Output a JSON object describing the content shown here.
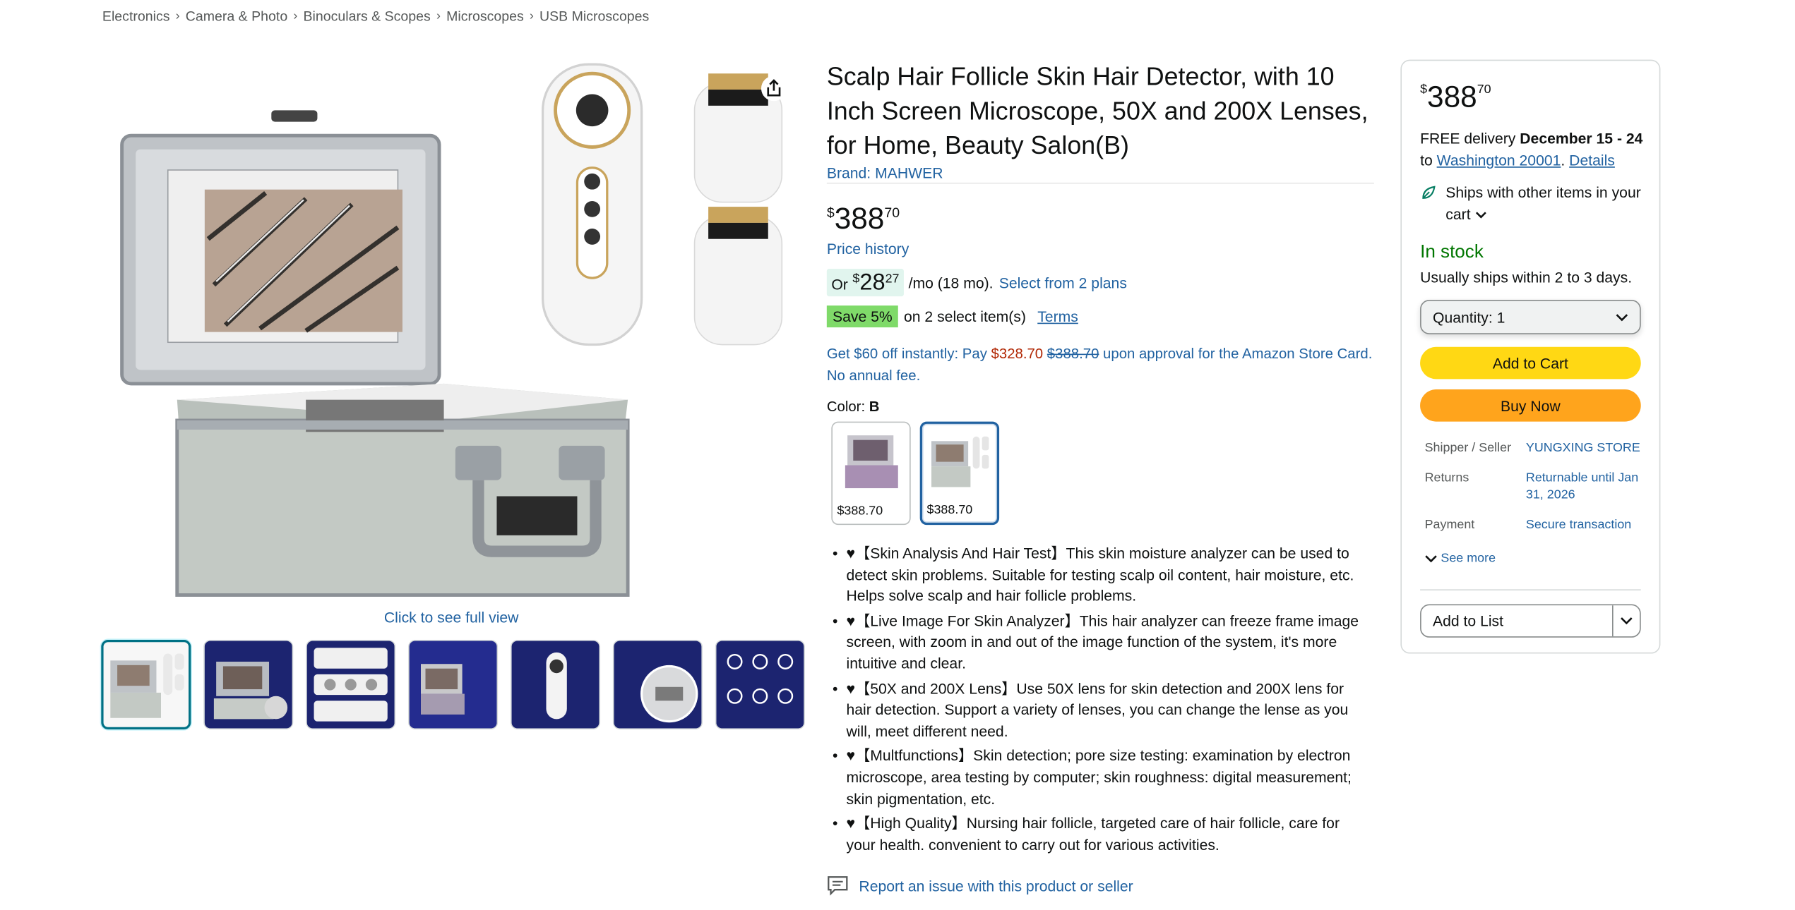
{
  "breadcrumb": [
    "Electronics",
    "Camera & Photo",
    "Binoculars & Scopes",
    "Microscopes",
    "USB Microscopes"
  ],
  "breadcrumb_separator": "›",
  "gallery": {
    "full_view_label": "Click to see full view",
    "thumbnail_count": 7
  },
  "product": {
    "title": "Scalp Hair Follicle Skin Hair Detector, with 10 Inch Screen Microscope, 50X and 200X Lenses, for Home, Beauty Salon(B)",
    "brand": "Brand: MAHWER",
    "price": {
      "symbol": "$",
      "whole": "388",
      "fraction": "70"
    },
    "price_history": "Price history",
    "monthly": {
      "or": "Or",
      "symbol": "$",
      "whole": "28",
      "fraction": "27",
      "per": "/mo (18 mo).",
      "plans": "Select from 2 plans"
    },
    "save": {
      "badge": "Save 5%",
      "text": "on 2 select item(s)",
      "terms": "Terms"
    },
    "card_offer": {
      "prefix": "Get $60 off instantly: Pay ",
      "new_price": "$328.70",
      "old_price": "$388.70",
      "suffix": " upon approval for the Amazon Store Card. No annual fee."
    },
    "color": {
      "label": "Color:",
      "value": "B"
    },
    "swatches": [
      {
        "price": "$388.70",
        "selected": false
      },
      {
        "price": "$388.70",
        "selected": true
      }
    ],
    "bullets": [
      "♥【Skin Analysis And Hair Test】This skin moisture analyzer can be used to detect skin problems. Suitable for testing scalp oil content, hair moisture, etc. Helps solve scalp and hair follicle problems.",
      "♥【Live Image For Skin Analyzer】This hair analyzer can freeze frame image screen, with zoom in and out of the image function of the system, it's more intuitive and clear.",
      "♥【50X and 200X Lens】Use 50X lens for skin detection and 200X lens for hair detection. Support a variety of lenses, you can change the lense as you will, meet different need.",
      "♥【Multfunctions】Skin detection; pore size testing: examination by electron microscope, area testing by computer; skin roughness: digital measurement; skin pigmentation, etc.",
      "♥【High Quality】Nursing hair follicle, targeted care of hair follicle, care for your health. convenient to carry out for various activities."
    ],
    "report": "Report an issue with this product or seller"
  },
  "buybox": {
    "price": {
      "symbol": "$",
      "whole": "388",
      "fraction": "70"
    },
    "delivery_prefix": "FREE delivery ",
    "delivery_date": "December 15 - 24",
    "delivery_to": "to ",
    "location": "Washington 20001",
    "details": "Details",
    "ships_with": "Ships with other items in your cart",
    "stock": "In stock",
    "usually": "Usually ships within 2 to 3 days.",
    "quantity_label": "Quantity:",
    "quantity_value": "1",
    "add_to_cart": "Add to Cart",
    "buy_now": "Buy Now",
    "info": [
      {
        "key": "Shipper / Seller",
        "value": "YUNGXING STORE"
      },
      {
        "key": "Returns",
        "value": "Returnable until Jan 31, 2026"
      },
      {
        "key": "Payment",
        "value": "Secure transaction"
      }
    ],
    "see_more": "See more",
    "add_to_list": "Add to List"
  },
  "colors": {
    "link": "#2162a1",
    "in_stock": "#007600",
    "add_to_cart": "#ffd814",
    "buy_now": "#ffa41c",
    "save_badge": "#7fda69",
    "offer_price": "#b12704"
  }
}
